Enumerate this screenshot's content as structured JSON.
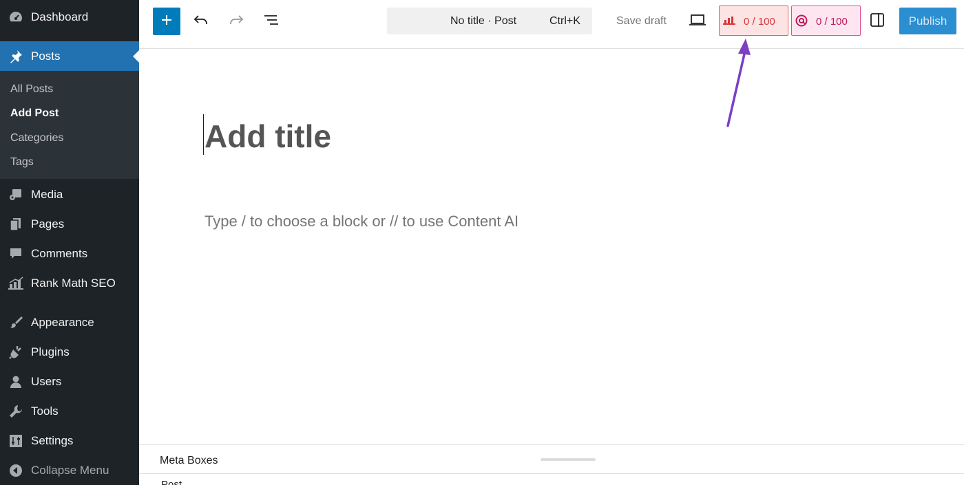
{
  "sidebar": {
    "dashboard": "Dashboard",
    "posts": "Posts",
    "posts_sub": [
      "All Posts",
      "Add Post",
      "Categories",
      "Tags"
    ],
    "media": "Media",
    "pages": "Pages",
    "comments": "Comments",
    "rankmath": "Rank Math SEO",
    "appearance": "Appearance",
    "plugins": "Plugins",
    "users": "Users",
    "tools": "Tools",
    "settings": "Settings",
    "collapse": "Collapse Menu"
  },
  "toolbar": {
    "command_title": "No title · Post",
    "command_shortcut": "Ctrl+K",
    "save_draft": "Save draft",
    "seo_score": "0 / 100",
    "content_ai_score": "0 / 100",
    "publish": "Publish"
  },
  "editor": {
    "title_placeholder": "Add title",
    "block_placeholder": "Type / to choose a block or // to use Content AI"
  },
  "meta": {
    "title": "Meta Boxes",
    "post_label": "Post"
  },
  "colors": {
    "sidebar_bg": "#1d2327",
    "active_menu": "#2271b1",
    "primary": "#007cba",
    "annotation_arrow": "#7b3fc4",
    "seo_score": "#d63638"
  },
  "icons": {
    "dashboard": "dashboard-icon",
    "posts": "pin-icon",
    "media": "media-icon",
    "pages": "pages-icon",
    "comments": "comment-icon",
    "rankmath": "rank-math-icon",
    "appearance": "brush-icon",
    "plugins": "plug-icon",
    "users": "user-icon",
    "tools": "wrench-icon",
    "settings": "settings-icon",
    "collapse": "collapse-icon"
  }
}
